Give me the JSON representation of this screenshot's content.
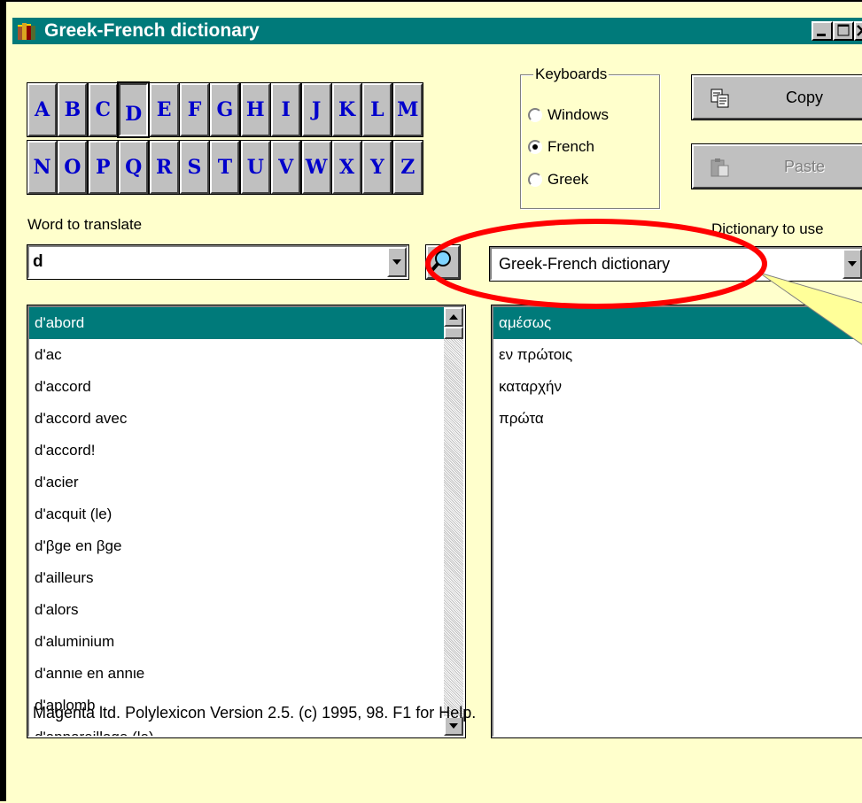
{
  "window": {
    "title": "Greek-French dictionary",
    "title_bar_color": "#007A7A",
    "background_color": "#FFFFCC"
  },
  "alphabet": {
    "row1": [
      "A",
      "B",
      "C",
      "D",
      "E",
      "F",
      "G",
      "H",
      "I",
      "J",
      "K",
      "L",
      "M"
    ],
    "row2": [
      "N",
      "O",
      "P",
      "Q",
      "R",
      "S",
      "T",
      "U",
      "V",
      "W",
      "X",
      "Y",
      "Z"
    ],
    "pressed": "D",
    "letter_color": "#0000CC"
  },
  "keyboards": {
    "legend": "Keyboards",
    "options": [
      "Windows",
      "French",
      "Greek"
    ],
    "selected": "French"
  },
  "buttons": {
    "copy_label": "Copy",
    "paste_label": "Paste",
    "copy_icon": "copy-icon",
    "paste_icon": "paste-icon",
    "search_icon": "magnifier-icon"
  },
  "word": {
    "label": "Word to translate",
    "value": "d"
  },
  "dictionary": {
    "label": "Dictionary to use",
    "value": "Greek-French dictionary"
  },
  "word_list": {
    "items": [
      "d'abord",
      "d'ac",
      "d'accord",
      "d'accord avec",
      "d'accord!",
      "d'acier",
      "d'acquit (le)",
      "d'βge en βge",
      "d'ailleurs",
      "d'alors",
      "d'aluminium",
      "d'annιe en annιe",
      "d'aplomb",
      "d'appareillage (le)"
    ],
    "selected_index": 0
  },
  "translations": {
    "items": [
      "αμέσως",
      "εν πρώτοις",
      "καταρχήν",
      "πρώτα"
    ],
    "selected_index": 0
  },
  "annotation": {
    "circle_color": "#FF0000",
    "arrow_color": "#FFFF99"
  },
  "status": {
    "text": "Magenta ltd. Polylexicon  Version 2.5. (c) 1995, 98. F1 for Help."
  }
}
